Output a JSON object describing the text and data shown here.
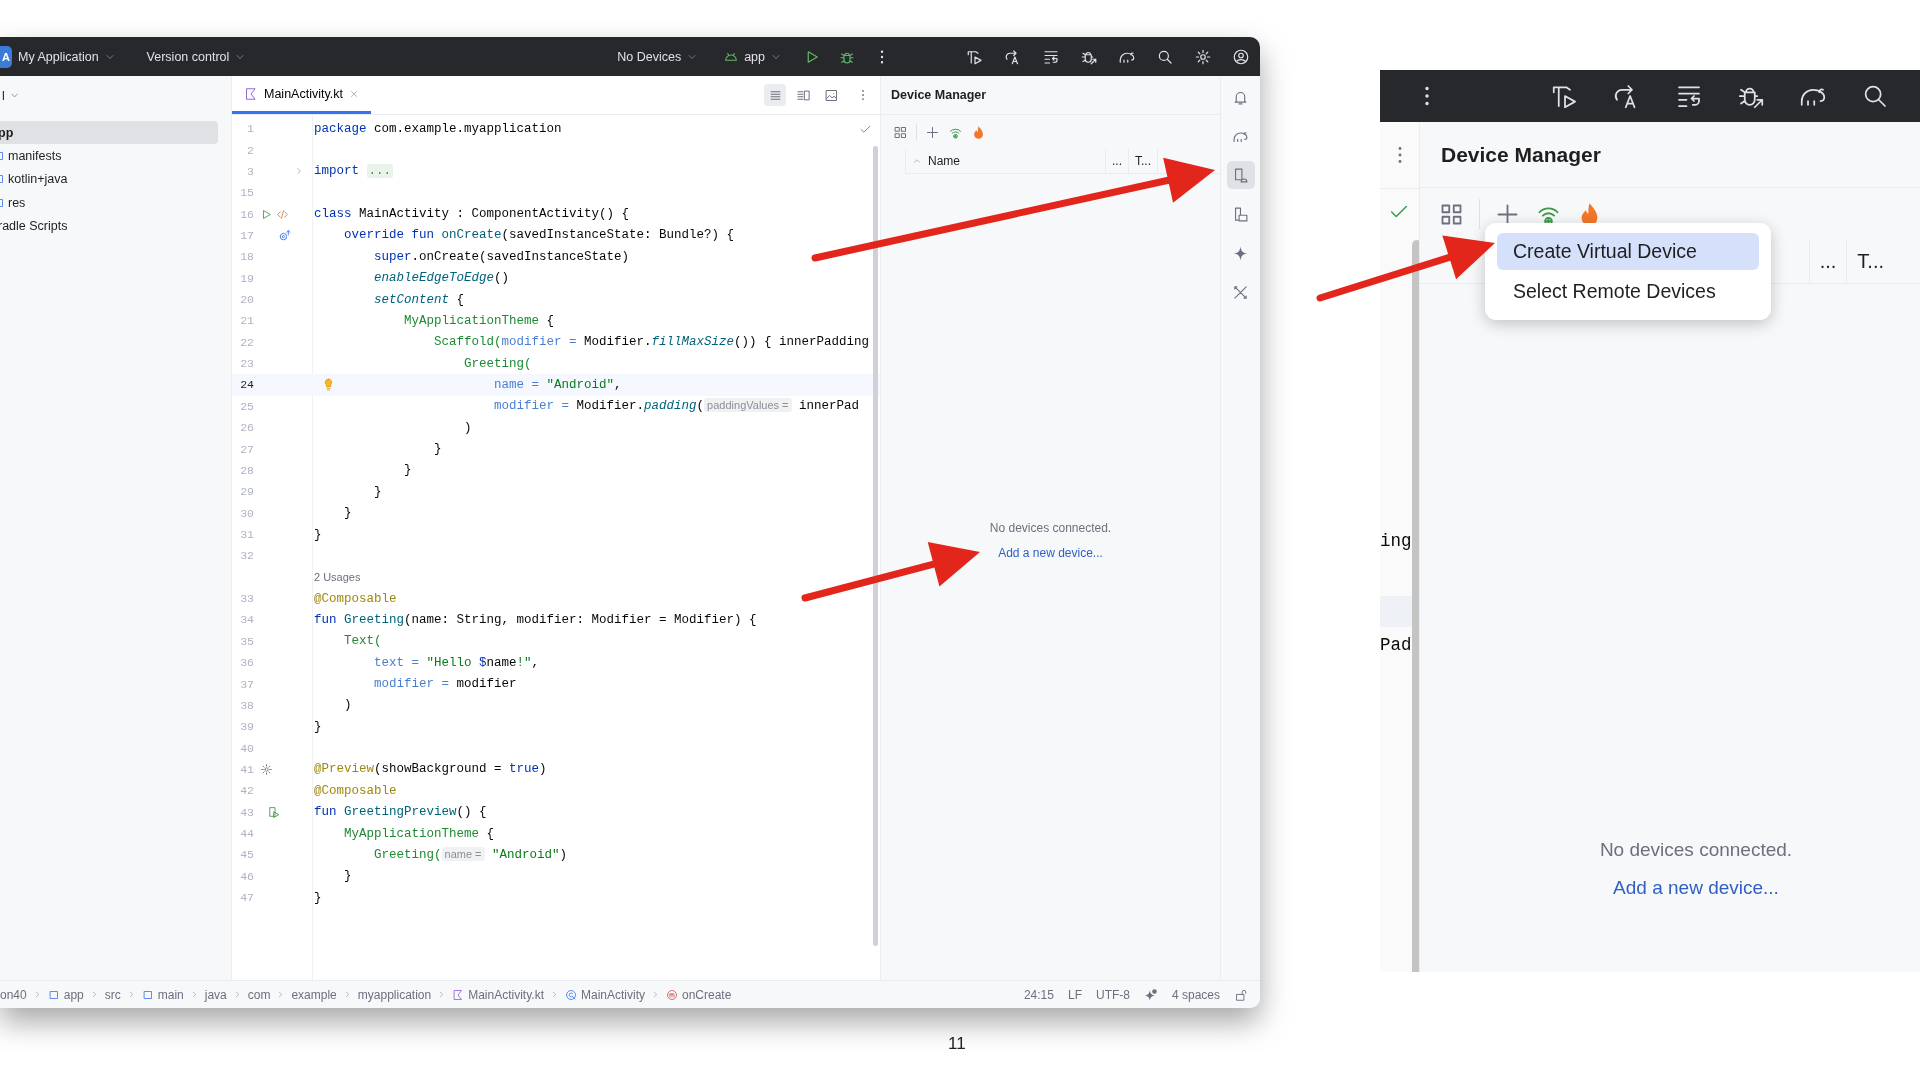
{
  "page": {
    "page_number": "11"
  },
  "ide_window": {
    "toolbar": {
      "project_initial": "A",
      "project": "My Application",
      "vcs": "Version control",
      "device_selector": "No Devices",
      "run_config": "app"
    },
    "project_panel": {
      "header": "l",
      "tree": [
        {
          "label": "pp",
          "selected": true,
          "children": [
            {
              "label": "manifests",
              "selected": false
            },
            {
              "label": "kotlin+java",
              "selected": false
            },
            {
              "label": "res",
              "selected": false
            }
          ]
        },
        {
          "label": "radle Scripts",
          "selected": false
        }
      ]
    },
    "editor": {
      "tabs": [
        {
          "label": "MainActivity.kt",
          "selected": true
        }
      ],
      "view_modes": [
        {
          "kind": "code",
          "selected": true
        },
        {
          "kind": "split",
          "selected": false
        },
        {
          "kind": "design",
          "selected": false
        }
      ],
      "lines": [
        {
          "kind": "code",
          "number": "1",
          "current": false,
          "tokens": [
            {
              "kind": "keyword",
              "text": "package"
            },
            {
              "kind": "plain",
              "text": " com.example.myapplication"
            }
          ]
        },
        {
          "kind": "code",
          "number": "2",
          "current": false
        },
        {
          "kind": "code",
          "number": "3",
          "current": false,
          "gutter": [
            {
              "kind": "fold"
            }
          ],
          "tokens": [
            {
              "kind": "keyword",
              "text": "import"
            },
            {
              "kind": "fold",
              "text": "..."
            }
          ]
        },
        {
          "kind": "code",
          "number": "15",
          "current": false
        },
        {
          "kind": "code",
          "number": "16",
          "current": false,
          "gutter": [
            {
              "kind": "run"
            },
            {
              "kind": "code"
            }
          ],
          "tokens": [
            {
              "kind": "keyword",
              "text": "class"
            },
            {
              "kind": "plain",
              "text": " MainActivity : ComponentActivity() {"
            }
          ]
        },
        {
          "kind": "code",
          "number": "17",
          "current": false,
          "gutter": [
            {
              "kind": "override"
            }
          ],
          "tokens": [
            {
              "kind": "keyword",
              "text": "    override fun"
            },
            {
              "kind": "declaration",
              "text": " onCreate"
            },
            {
              "kind": "plain",
              "text": "(savedInstanceState: Bundle?) {"
            }
          ]
        },
        {
          "kind": "code",
          "number": "18",
          "current": false,
          "tokens": [
            {
              "kind": "keyword",
              "text": "        super"
            },
            {
              "kind": "plain",
              "text": ".onCreate(savedInstanceState)"
            }
          ]
        },
        {
          "kind": "code",
          "number": "19",
          "current": false,
          "tokens": [
            {
              "kind": "extension",
              "text": "        enableEdgeToEdge"
            },
            {
              "kind": "plain",
              "text": "()"
            }
          ]
        },
        {
          "kind": "code",
          "number": "20",
          "current": false,
          "tokens": [
            {
              "kind": "extension",
              "text": "        setContent"
            },
            {
              "kind": "plain",
              "text": " {"
            }
          ]
        },
        {
          "kind": "code",
          "number": "21",
          "current": false,
          "tokens": [
            {
              "kind": "composable",
              "text": "            MyApplicationTheme"
            },
            {
              "kind": "plain",
              "text": " {"
            }
          ]
        },
        {
          "kind": "code",
          "number": "22",
          "current": false,
          "tokens": [
            {
              "kind": "composable",
              "text": "                Scaffold("
            },
            {
              "kind": "named_arg",
              "text": "modifier ="
            },
            {
              "kind": "plain",
              "text": " Modifier."
            },
            {
              "kind": "extension",
              "text": "fillMaxSize"
            },
            {
              "kind": "plain",
              "text": "()) { innerPadding"
            }
          ]
        },
        {
          "kind": "code",
          "number": "23",
          "current": false,
          "tokens": [
            {
              "kind": "composable",
              "text": "                    Greeting("
            }
          ]
        },
        {
          "kind": "code",
          "number": "24",
          "current": true,
          "gutter": [
            {
              "kind": "bulb"
            }
          ],
          "tokens": [
            {
              "kind": "named_arg",
              "text": "                        name ="
            },
            {
              "kind": "string",
              "text": " \"Android\""
            },
            {
              "kind": "plain",
              "text": ","
            }
          ]
        },
        {
          "kind": "code",
          "number": "25",
          "current": false,
          "tokens": [
            {
              "kind": "named_arg",
              "text": "                        modifier ="
            },
            {
              "kind": "plain",
              "text": " Modifier."
            },
            {
              "kind": "extension",
              "text": "padding"
            },
            {
              "kind": "plain",
              "text": "("
            },
            {
              "kind": "hint",
              "text": "paddingValues ="
            },
            {
              "kind": "plain",
              "text": " innerPad"
            }
          ]
        },
        {
          "kind": "code",
          "number": "26",
          "current": false,
          "tokens": [
            {
              "kind": "plain",
              "text": "                    )"
            }
          ]
        },
        {
          "kind": "code",
          "number": "27",
          "current": false,
          "tokens": [
            {
              "kind": "plain",
              "text": "                }"
            }
          ]
        },
        {
          "kind": "code",
          "number": "28",
          "current": false,
          "tokens": [
            {
              "kind": "plain",
              "text": "            }"
            }
          ]
        },
        {
          "kind": "code",
          "number": "29",
          "current": false,
          "tokens": [
            {
              "kind": "plain",
              "text": "        }"
            }
          ]
        },
        {
          "kind": "code",
          "number": "30",
          "current": false,
          "tokens": [
            {
              "kind": "plain",
              "text": "    }"
            }
          ]
        },
        {
          "kind": "code",
          "number": "31",
          "current": false,
          "tokens": [
            {
              "kind": "plain",
              "text": "}"
            }
          ]
        },
        {
          "kind": "code",
          "number": "32",
          "current": false
        },
        {
          "kind": "usages",
          "text": "2 Usages"
        },
        {
          "kind": "code",
          "number": "33",
          "current": false,
          "tokens": [
            {
              "kind": "annotation",
              "text": "@Composable"
            }
          ]
        },
        {
          "kind": "code",
          "number": "34",
          "current": false,
          "tokens": [
            {
              "kind": "keyword",
              "text": "fun"
            },
            {
              "kind": "declaration",
              "text": " Greeting"
            },
            {
              "kind": "plain",
              "text": "(name: String, modifier: Modifier = Modifier) {"
            }
          ]
        },
        {
          "kind": "code",
          "number": "35",
          "current": false,
          "tokens": [
            {
              "kind": "composable",
              "text": "    Text("
            }
          ]
        },
        {
          "kind": "code",
          "number": "36",
          "current": false,
          "tokens": [
            {
              "kind": "named_arg",
              "text": "        text ="
            },
            {
              "kind": "string",
              "text": " \"Hello "
            },
            {
              "kind": "keyword",
              "text": "$"
            },
            {
              "kind": "plain",
              "text": "name"
            },
            {
              "kind": "string",
              "text": "!\""
            },
            {
              "kind": "plain",
              "text": ","
            }
          ]
        },
        {
          "kind": "code",
          "number": "37",
          "current": false,
          "tokens": [
            {
              "kind": "named_arg",
              "text": "        modifier ="
            },
            {
              "kind": "plain",
              "text": " modifier"
            }
          ]
        },
        {
          "kind": "code",
          "number": "38",
          "current": false,
          "tokens": [
            {
              "kind": "plain",
              "text": "    )"
            }
          ]
        },
        {
          "kind": "code",
          "number": "39",
          "current": false,
          "tokens": [
            {
              "kind": "plain",
              "text": "}"
            }
          ]
        },
        {
          "kind": "code",
          "number": "40",
          "current": false
        },
        {
          "kind": "code",
          "number": "41",
          "current": false,
          "gutter": [
            {
              "kind": "gear"
            }
          ],
          "tokens": [
            {
              "kind": "annotation",
              "text": "@Preview"
            },
            {
              "kind": "plain",
              "text": "(showBackground = "
            },
            {
              "kind": "keyword",
              "text": "true"
            },
            {
              "kind": "plain",
              "text": ")"
            }
          ]
        },
        {
          "kind": "code",
          "number": "42",
          "current": false,
          "tokens": [
            {
              "kind": "annotation",
              "text": "@Composable"
            }
          ]
        },
        {
          "kind": "code",
          "number": "43",
          "current": false,
          "gutter": [
            {
              "kind": "preview"
            }
          ],
          "tokens": [
            {
              "kind": "keyword",
              "text": "fun"
            },
            {
              "kind": "declaration",
              "text": " GreetingPreview"
            },
            {
              "kind": "plain",
              "text": "() {"
            }
          ]
        },
        {
          "kind": "code",
          "number": "44",
          "current": false,
          "tokens": [
            {
              "kind": "composable",
              "text": "    MyApplicationTheme"
            },
            {
              "kind": "plain",
              "text": " {"
            }
          ]
        },
        {
          "kind": "code",
          "number": "45",
          "current": false,
          "tokens": [
            {
              "kind": "composable",
              "text": "        Greeting("
            },
            {
              "kind": "hint",
              "text": "name ="
            },
            {
              "kind": "string",
              "text": " \"Android\""
            },
            {
              "kind": "plain",
              "text": ")"
            }
          ]
        },
        {
          "kind": "code",
          "number": "46",
          "current": false,
          "tokens": [
            {
              "kind": "plain",
              "text": "    }"
            }
          ]
        },
        {
          "kind": "code",
          "number": "47",
          "current": false,
          "tokens": [
            {
              "kind": "plain",
              "text": "}"
            }
          ]
        }
      ]
    },
    "device_manager": {
      "title": "Device Manager",
      "columns": [
        {
          "label": "Name",
          "sorted": true
        },
        {
          "label": "...",
          "sorted": false
        },
        {
          "label": "T...",
          "sorted": false
        }
      ],
      "empty_text": "No devices connected.",
      "link": "Add a new device..."
    },
    "tool_strip": [
      {
        "kind": "notifications",
        "selected": false
      },
      {
        "kind": "gradle",
        "selected": false
      },
      {
        "kind": "device_manager",
        "selected": true
      },
      {
        "kind": "running_devices",
        "selected": false
      },
      {
        "kind": "gemini",
        "selected": false
      },
      {
        "kind": "tools",
        "selected": false
      }
    ],
    "status_bar": {
      "breadcrumbs": [
        {
          "kind": "plain",
          "label": "on40"
        },
        {
          "kind": "module",
          "label": "app"
        },
        {
          "kind": "plain",
          "label": "src"
        },
        {
          "kind": "module",
          "label": "main"
        },
        {
          "kind": "plain",
          "label": "java"
        },
        {
          "kind": "plain",
          "label": "com"
        },
        {
          "kind": "plain",
          "label": "example"
        },
        {
          "kind": "plain",
          "label": "myapplication"
        },
        {
          "kind": "kotlin_file",
          "label": "MainActivity.kt"
        },
        {
          "kind": "class",
          "label": "MainActivity"
        },
        {
          "kind": "method",
          "label": "onCreate"
        }
      ],
      "position": "24:15",
      "line_separator": "LF",
      "encoding": "UTF-8",
      "indent": "4 spaces"
    }
  },
  "zoomed_window": {
    "editor_fragments": [
      "ing",
      "Pad"
    ],
    "device_manager": {
      "title": "Device Manager",
      "menu": [
        {
          "label": "Create Virtual Device",
          "selected": true
        },
        {
          "label": "Select Remote Devices",
          "selected": false
        }
      ],
      "columns": [
        "...",
        "T..."
      ],
      "empty_text": "No devices connected.",
      "link": "Add a new device..."
    }
  },
  "annotations": [
    {
      "kind": "arrow"
    },
    {
      "kind": "arrow"
    },
    {
      "kind": "arrow"
    }
  ]
}
